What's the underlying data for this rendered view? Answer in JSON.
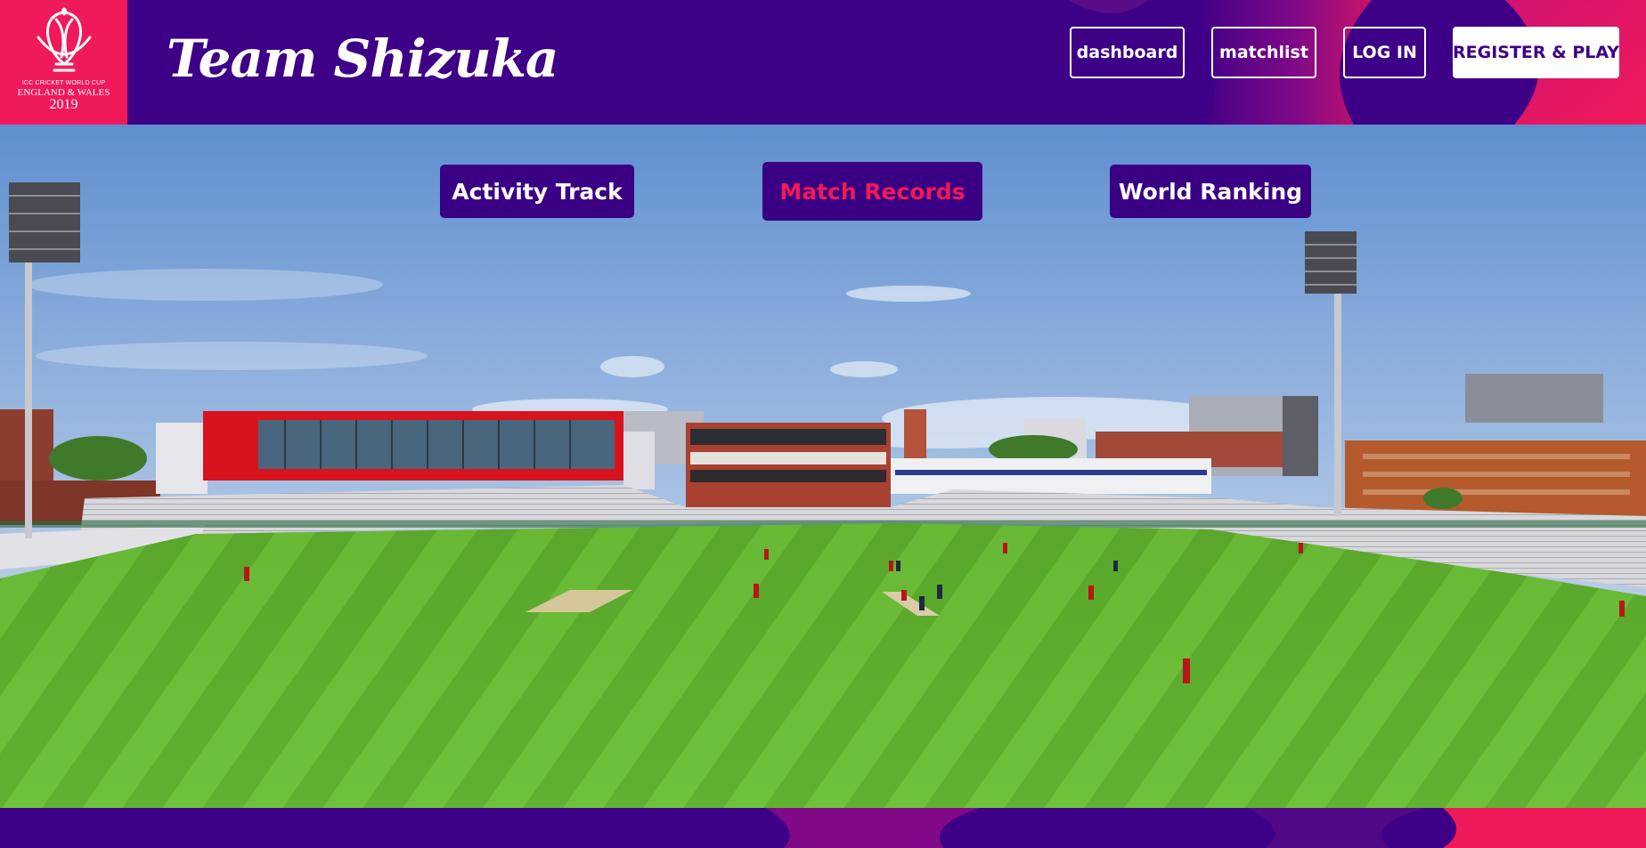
{
  "colors": {
    "brand_purple": "#3d0086",
    "brand_pink": "#f0195a",
    "white": "#ffffff"
  },
  "logo": {
    "icon": "world-cup-trophy-icon",
    "line1": "ICC CRICKET WORLD CUP",
    "line2": "ENGLAND & WALES",
    "year": "2019"
  },
  "header": {
    "title": "Team Shizuka"
  },
  "nav": {
    "dashboard": "dashboard",
    "matchlist": "matchlist",
    "login": "LOG IN",
    "register": "REGISTER & PLAY"
  },
  "hero": {
    "tabs": [
      {
        "label": "Activity Track",
        "active": false
      },
      {
        "label": "Match Records",
        "active": true
      },
      {
        "label": "World Ranking",
        "active": false
      }
    ],
    "background": "cricket-stadium-image"
  }
}
